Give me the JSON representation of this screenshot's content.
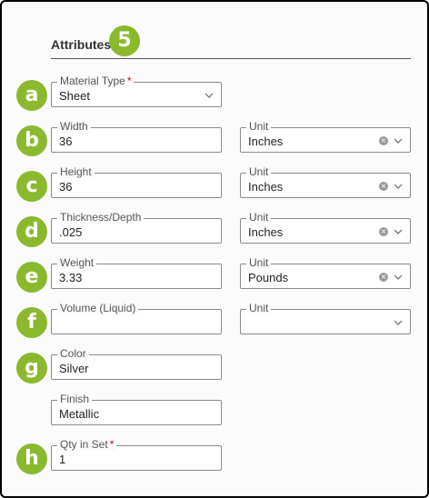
{
  "section": {
    "title": "Attributes",
    "step_badge": "5"
  },
  "badges": [
    "a",
    "b",
    "c",
    "d",
    "e",
    "f",
    "g",
    "h"
  ],
  "fields": {
    "material_type": {
      "label": "Material Type",
      "required": "*",
      "value": "Sheet"
    },
    "width": {
      "label": "Width",
      "value": "36"
    },
    "width_unit": {
      "label": "Unit",
      "value": "Inches"
    },
    "height": {
      "label": "Height",
      "value": "36"
    },
    "height_unit": {
      "label": "Unit",
      "value": "Inches"
    },
    "thickness": {
      "label": "Thickness/Depth",
      "value": ".025"
    },
    "thickness_unit": {
      "label": "Unit",
      "value": "Inches"
    },
    "weight": {
      "label": "Weight",
      "value": "3.33"
    },
    "weight_unit": {
      "label": "Unit",
      "value": "Pounds"
    },
    "volume": {
      "label": "Volume (Liquid)",
      "value": ""
    },
    "volume_unit": {
      "label": "Unit",
      "value": ""
    },
    "color": {
      "label": "Color",
      "value": "Silver"
    },
    "finish": {
      "label": "Finish",
      "value": "Metallic"
    },
    "qty_in_set": {
      "label": "Qty in Set",
      "required": "*",
      "value": "1"
    }
  },
  "colors": {
    "badge": "#8ab92d",
    "required": "#d0021b",
    "border": "#8a8a8a"
  }
}
